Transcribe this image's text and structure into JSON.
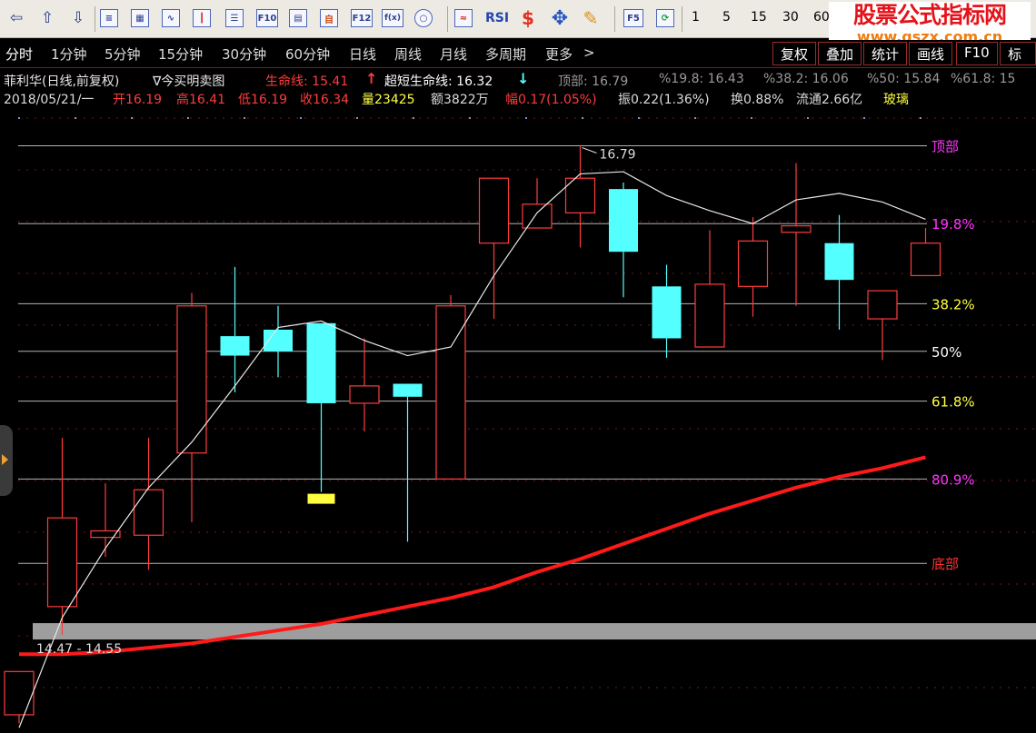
{
  "toolbar": {
    "icons": [
      "back-arrow",
      "up-arrow",
      "down-arrow",
      "report",
      "table",
      "line-chart",
      "candle-chart",
      "layout",
      "F10",
      "F10-doc",
      "self-select",
      "F12",
      "function",
      "circle",
      "indicator",
      "RSI",
      "dollar",
      "move",
      "pen",
      "F5",
      "refresh"
    ],
    "labels": {
      "f10": "F10",
      "f12": "F12",
      "rsi": "RSI",
      "f5": "F5",
      "fx": "f(x)"
    },
    "period_numbers": [
      "1",
      "5",
      "15",
      "30",
      "60"
    ]
  },
  "watermark": {
    "title": "股票公式指标网",
    "url": "www.gszx.com.cn"
  },
  "tabs": {
    "items": [
      "分时",
      "1分钟",
      "5分钟",
      "15分钟",
      "30分钟",
      "60分钟",
      "日线",
      "周线",
      "月线",
      "多周期",
      "更多"
    ],
    "more_arrow": ">",
    "right_buttons": [
      "复权",
      "叠加",
      "统计",
      "画线",
      "F10",
      "标"
    ]
  },
  "line1": {
    "title": "菲利华(日线,前复权)",
    "formula": "∇今买明卖图",
    "life_label": "生命线: 15.41",
    "life_arrow": "↑",
    "short_label": "超短生命线: 16.32",
    "short_arrow": "↓",
    "top": "顶部: 16.79",
    "p198": "%19.8: 16.43",
    "p382": "%38.2: 16.06",
    "p50": "%50: 15.84",
    "p618": "%61.8: 15"
  },
  "line2": {
    "date": "2018/05/21/一",
    "open": "开16.19",
    "high": "高16.41",
    "low": "低16.19",
    "close": "收16.34",
    "vol": "量23425",
    "amount": "额3822万",
    "change": "幅0.17(1.05%)",
    "amp": "振0.22(1.36%)",
    "turnover": "换0.88%",
    "float": "流通2.66亿",
    "sector": "玻璃"
  },
  "colors": {
    "bull": "#ff3c3c",
    "bear": "#54ffff",
    "ma": "#e8e8e8",
    "life": "#ff1a1a",
    "magenta": "#ff33ff",
    "yellow": "#ffff40",
    "grid": "#7a1818"
  },
  "chart_data": {
    "type": "candlestick",
    "ylim": [
      14.08,
      16.96
    ],
    "levels": [
      {
        "name": "顶部",
        "value": 16.79,
        "color": "#ff33ff"
      },
      {
        "name": "19.8%",
        "value": 16.43,
        "color": "#ff33ff"
      },
      {
        "name": "38.2%",
        "value": 16.06,
        "color": "#ffff40"
      },
      {
        "name": "50%",
        "value": 15.84,
        "color": "#ffffff"
      },
      {
        "name": "61.8%",
        "value": 15.61,
        "color": "#ffff40"
      },
      {
        "name": "80.9%",
        "value": 15.25,
        "color": "#ff33ff"
      },
      {
        "name": "底部",
        "value": 14.86,
        "color": "#ff3030"
      }
    ],
    "candles": [
      {
        "o": 14.16,
        "h": 14.15,
        "l": 14.12,
        "c": 14.36
      },
      {
        "o": 14.66,
        "h": 15.44,
        "l": 14.53,
        "c": 15.07
      },
      {
        "o": 14.98,
        "h": 15.23,
        "l": 14.89,
        "c": 15.01
      },
      {
        "o": 14.99,
        "h": 15.44,
        "l": 14.83,
        "c": 15.2
      },
      {
        "o": 15.37,
        "h": 16.11,
        "l": 15.05,
        "c": 16.05
      },
      {
        "o": 15.91,
        "h": 16.23,
        "l": 15.65,
        "c": 15.82
      },
      {
        "o": 15.94,
        "h": 16.05,
        "l": 15.72,
        "c": 15.84
      },
      {
        "o": 15.97,
        "h": 15.97,
        "l": 15.19,
        "c": 15.6
      },
      {
        "o": 15.6,
        "h": 15.9,
        "l": 15.47,
        "c": 15.68
      },
      {
        "o": 15.69,
        "h": 15.69,
        "l": 14.96,
        "c": 15.63
      },
      {
        "o": 15.25,
        "h": 16.1,
        "l": 15.25,
        "c": 16.05
      },
      {
        "o": 16.34,
        "h": 16.56,
        "l": 15.99,
        "c": 16.64
      },
      {
        "o": 16.41,
        "h": 16.64,
        "l": 16.41,
        "c": 16.52
      },
      {
        "o": 16.48,
        "h": 16.79,
        "l": 16.32,
        "c": 16.64
      },
      {
        "o": 16.59,
        "h": 16.62,
        "l": 16.09,
        "c": 16.3
      },
      {
        "o": 16.14,
        "h": 16.24,
        "l": 15.81,
        "c": 15.9
      },
      {
        "o": 15.86,
        "h": 16.4,
        "l": 15.86,
        "c": 16.15
      },
      {
        "o": 16.14,
        "h": 16.46,
        "l": 16.0,
        "c": 16.35
      },
      {
        "o": 16.39,
        "h": 16.71,
        "l": 16.05,
        "c": 16.42
      },
      {
        "o": 16.34,
        "h": 16.47,
        "l": 15.94,
        "c": 16.17
      },
      {
        "o": 15.99,
        "h": 16.12,
        "l": 15.8,
        "c": 16.12
      },
      {
        "o": 16.19,
        "h": 16.41,
        "l": 16.19,
        "c": 16.34
      }
    ],
    "short_life_line": [
      14.1,
      14.61,
      14.93,
      15.21,
      15.42,
      15.68,
      15.95,
      15.98,
      15.89,
      15.82,
      15.86,
      16.19,
      16.48,
      16.66,
      16.67,
      16.56,
      16.49,
      16.43,
      16.54,
      16.57,
      16.53,
      16.45
    ],
    "life_line": [
      14.44,
      14.44,
      14.45,
      14.47,
      14.49,
      14.52,
      14.55,
      14.58,
      14.62,
      14.66,
      14.7,
      14.75,
      14.82,
      14.88,
      14.95,
      15.02,
      15.09,
      15.15,
      15.21,
      15.26,
      15.3,
      15.35
    ],
    "annotations": {
      "top_price": "16.79",
      "bottom_range": "14.47 - 14.55"
    }
  }
}
